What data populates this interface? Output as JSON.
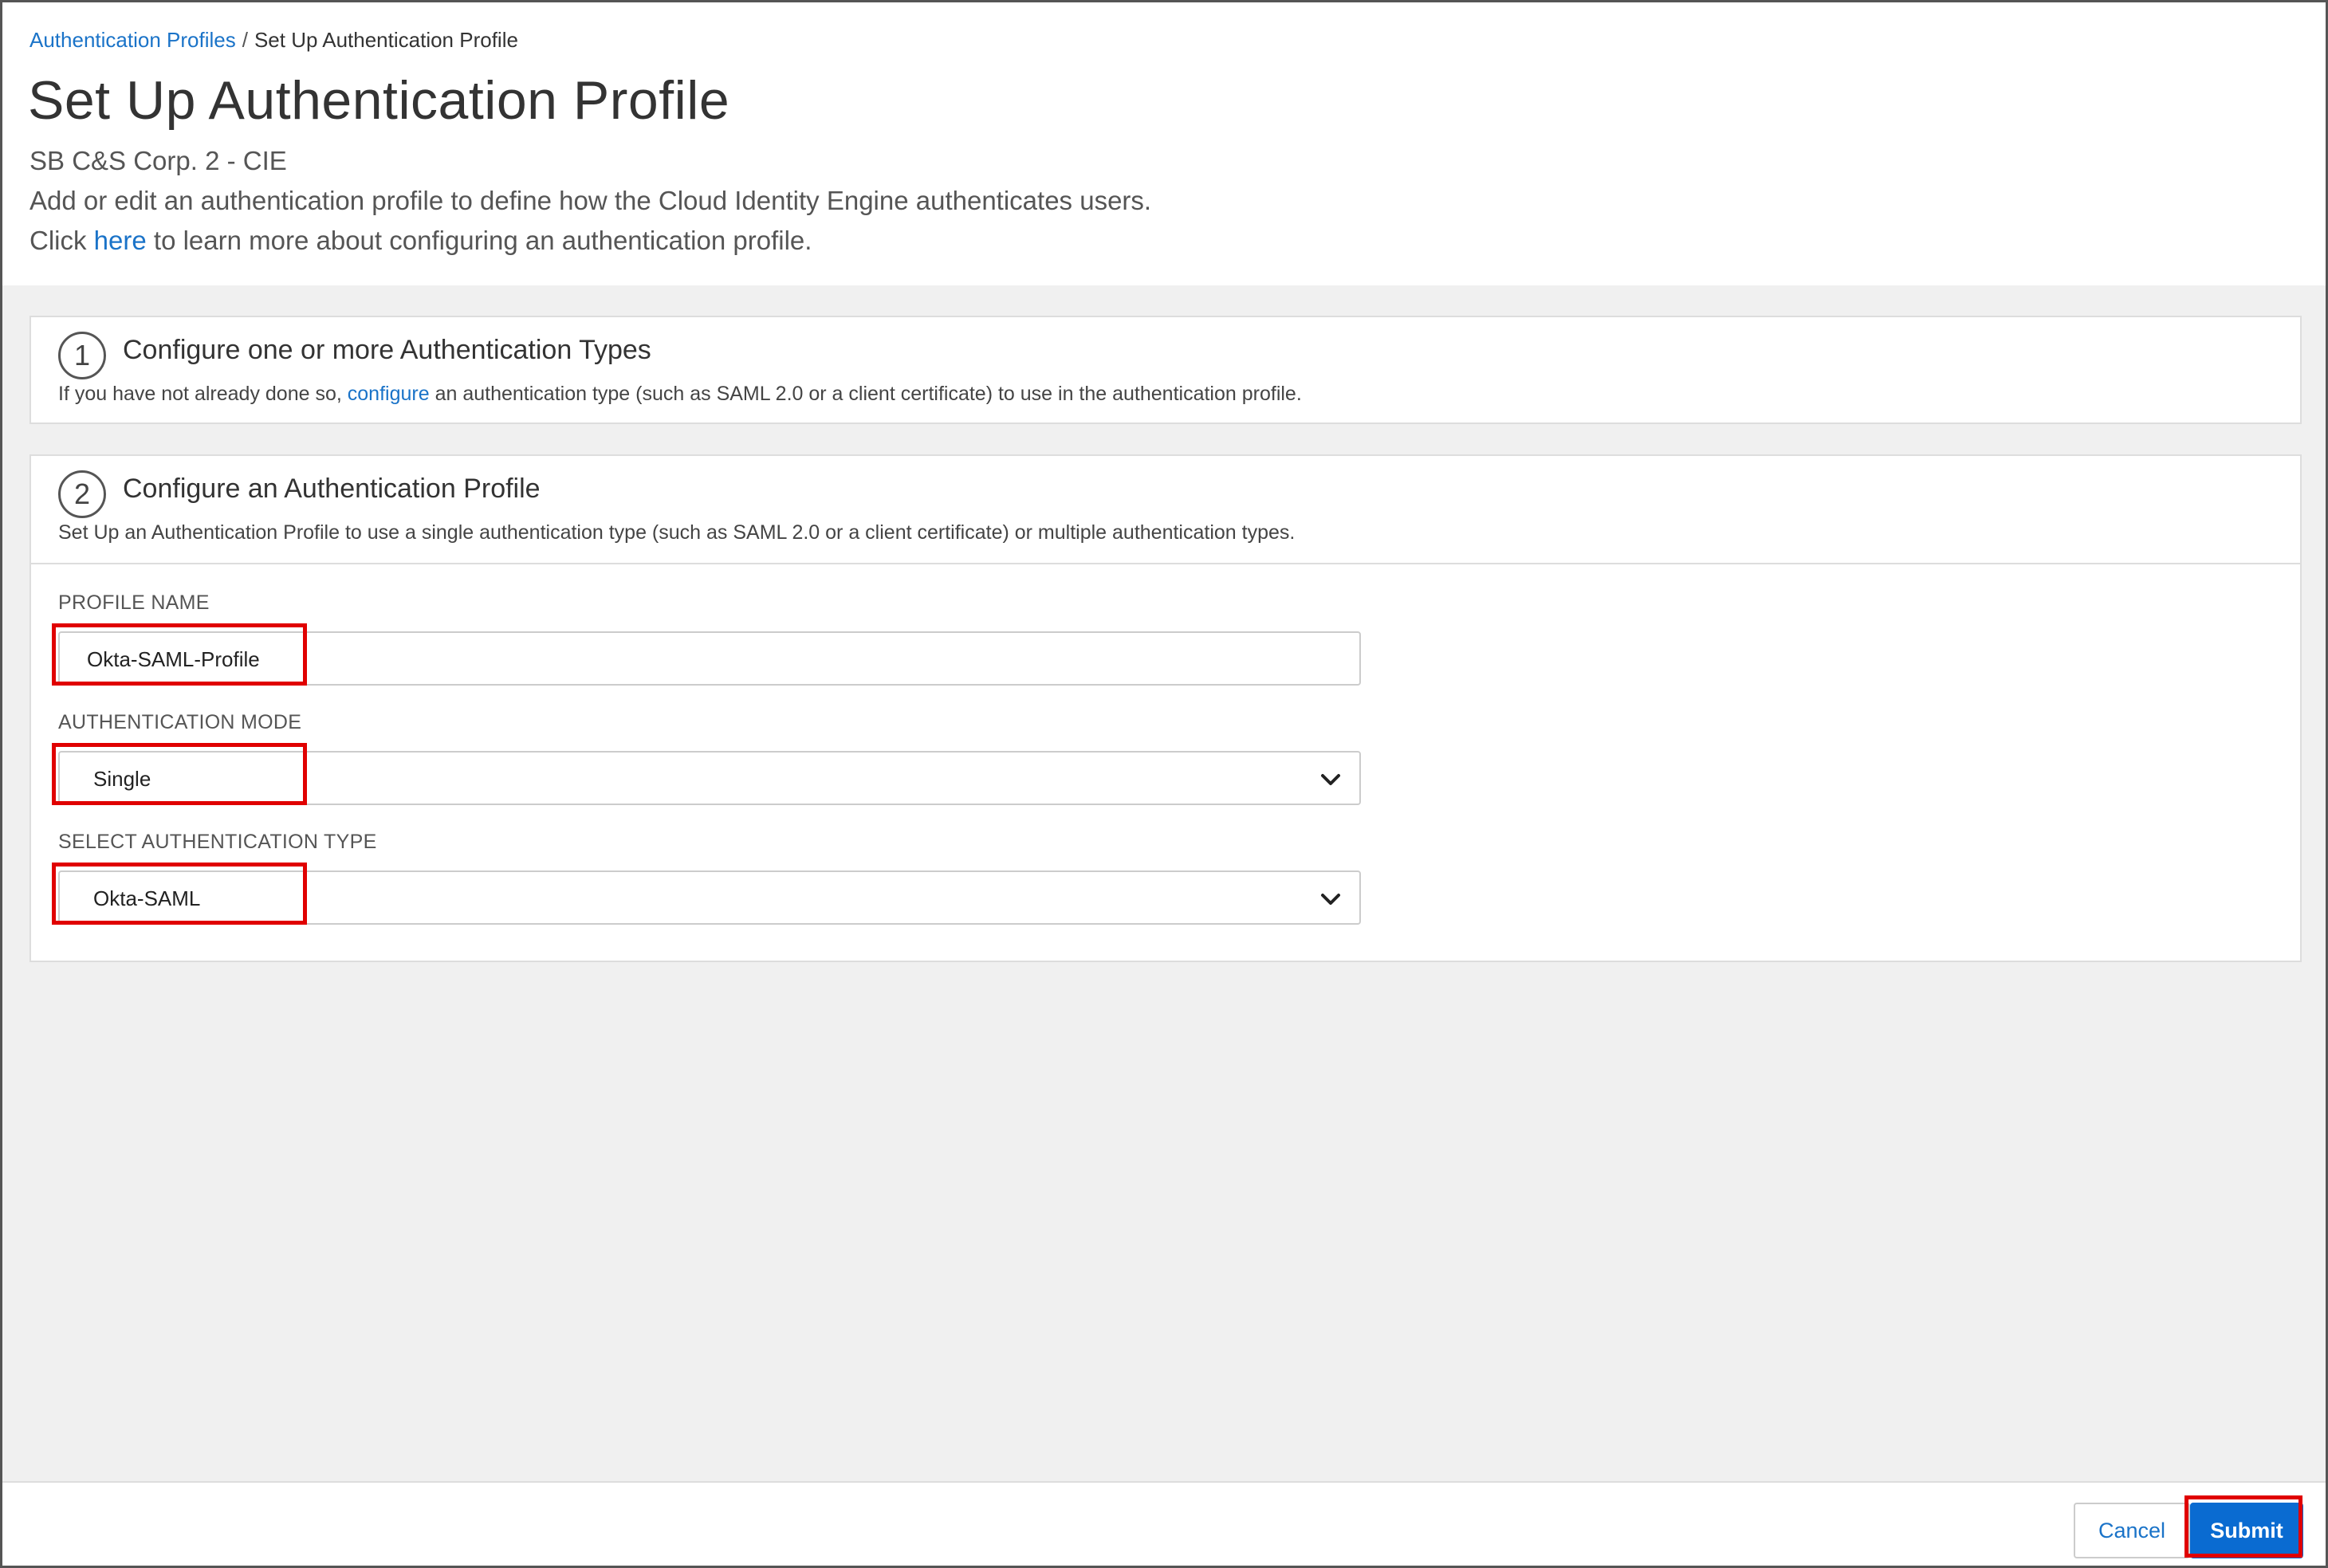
{
  "breadcrumb": {
    "parent": "Authentication Profiles",
    "separator": "/",
    "current": "Set Up Authentication Profile"
  },
  "page": {
    "title": "Set Up Authentication Profile",
    "subtitle": "SB C&S Corp. 2 - CIE",
    "description": "Add or edit an authentication profile to define how the Cloud Identity Engine authenticates users.",
    "help_prefix": "Click",
    "help_link": "here",
    "help_suffix": "to learn more about configuring an authentication profile."
  },
  "step1": {
    "number": "1",
    "title": "Configure one or more Authentication Types",
    "desc_prefix": "If you have not already done so,",
    "desc_link": "configure",
    "desc_suffix": "an authentication type (such as SAML 2.0 or a client certificate) to use in the authentication profile."
  },
  "step2": {
    "number": "2",
    "title": "Configure an Authentication Profile",
    "desc": "Set Up an Authentication Profile to use a single authentication type (such as SAML 2.0 or a client certificate) or multiple authentication types."
  },
  "form": {
    "profile_name_label": "PROFILE NAME",
    "profile_name_value": "Okta-SAML-Profile",
    "auth_mode_label": "AUTHENTICATION MODE",
    "auth_mode_value": "Single",
    "auth_type_label": "SELECT AUTHENTICATION TYPE",
    "auth_type_value": "Okta-SAML"
  },
  "footer": {
    "cancel_label": "Cancel",
    "submit_label": "Submit"
  },
  "colors": {
    "link": "#1a73c8",
    "primary_button": "#0a6bd1",
    "highlight": "#e00000",
    "content_bg": "#f0f0f0"
  }
}
